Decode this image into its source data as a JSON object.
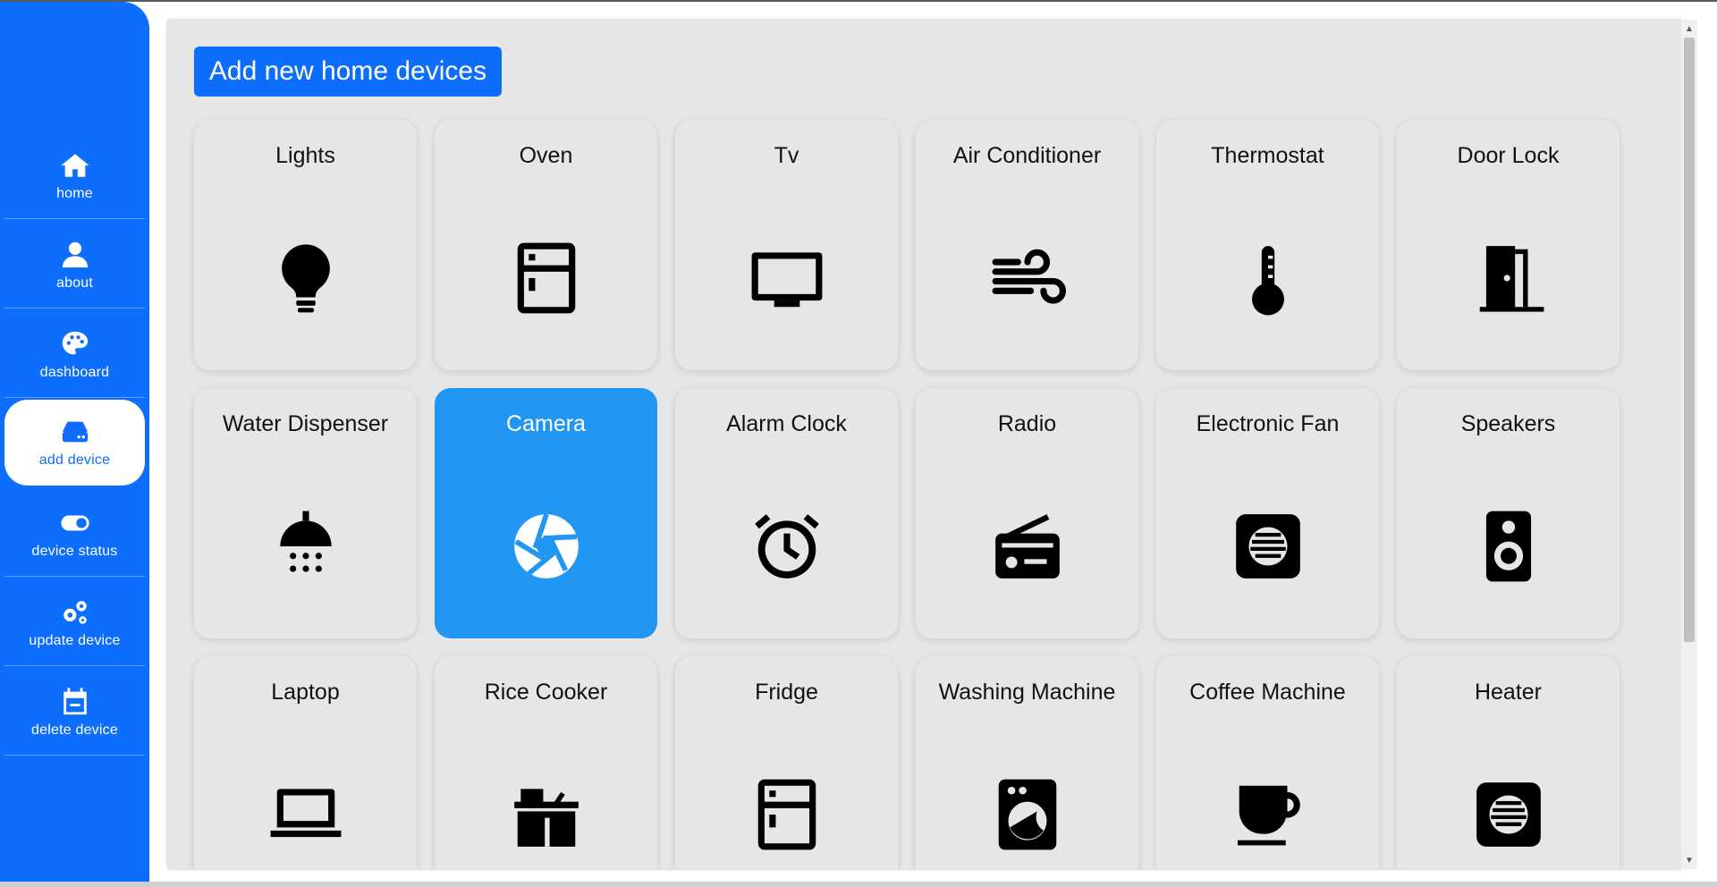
{
  "sidebar": {
    "items": [
      {
        "label": "home",
        "icon": "home-icon",
        "active": false
      },
      {
        "label": "about",
        "icon": "user-icon",
        "active": false
      },
      {
        "label": "dashboard",
        "icon": "palette-icon",
        "active": false
      },
      {
        "label": "add device",
        "icon": "hard-drive-icon",
        "active": true
      },
      {
        "label": "device status",
        "icon": "toggle-icon",
        "active": false
      },
      {
        "label": "update device",
        "icon": "gears-icon",
        "active": false
      },
      {
        "label": "delete device",
        "icon": "calendar-minus-icon",
        "active": false
      }
    ]
  },
  "main": {
    "add_button_label": "Add new home devices",
    "devices": [
      {
        "name": "Lights",
        "icon": "lightbulb-icon",
        "selected": false
      },
      {
        "name": "Oven",
        "icon": "oven-icon",
        "selected": false
      },
      {
        "name": "Tv",
        "icon": "tv-icon",
        "selected": false
      },
      {
        "name": "Air Conditioner",
        "icon": "wind-icon",
        "selected": false
      },
      {
        "name": "Thermostat",
        "icon": "thermometer-icon",
        "selected": false
      },
      {
        "name": "Door Lock",
        "icon": "door-icon",
        "selected": false
      },
      {
        "name": "Water Dispenser",
        "icon": "shower-icon",
        "selected": false
      },
      {
        "name": "Camera",
        "icon": "camera-aperture-icon",
        "selected": true
      },
      {
        "name": "Alarm Clock",
        "icon": "alarm-clock-icon",
        "selected": false
      },
      {
        "name": "Radio",
        "icon": "radio-icon",
        "selected": false
      },
      {
        "name": "Electronic Fan",
        "icon": "fan-icon",
        "selected": false
      },
      {
        "name": "Speakers",
        "icon": "speaker-icon",
        "selected": false
      },
      {
        "name": "Laptop",
        "icon": "laptop-icon",
        "selected": false
      },
      {
        "name": "Rice Cooker",
        "icon": "rice-cooker-icon",
        "selected": false
      },
      {
        "name": "Fridge",
        "icon": "fridge-icon",
        "selected": false
      },
      {
        "name": "Washing Machine",
        "icon": "washing-machine-icon",
        "selected": false
      },
      {
        "name": "Coffee Machine",
        "icon": "coffee-cup-icon",
        "selected": false
      },
      {
        "name": "Heater",
        "icon": "heater-icon",
        "selected": false
      }
    ]
  },
  "colors": {
    "sidebar_bg": "#0d6efd",
    "panel_bg": "#e6e6e6",
    "selected_card_bg": "#2196f3",
    "button_bg": "#0d6efd"
  }
}
